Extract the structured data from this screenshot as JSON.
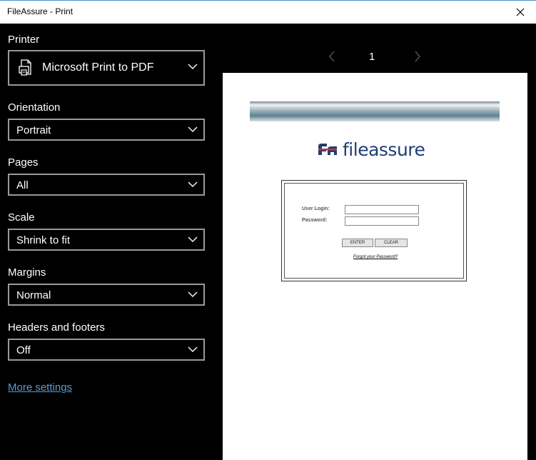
{
  "window": {
    "title": "FileAssure - Print"
  },
  "printer": {
    "label": "Printer",
    "value": "Microsoft Print to PDF"
  },
  "orientation": {
    "label": "Orientation",
    "value": "Portrait"
  },
  "pages": {
    "label": "Pages",
    "value": "All"
  },
  "scale": {
    "label": "Scale",
    "value": "Shrink to fit"
  },
  "margins": {
    "label": "Margins",
    "value": "Normal"
  },
  "headers_footers": {
    "label": "Headers and footers",
    "value": "Off"
  },
  "more_settings": "More settings",
  "pager": {
    "page": "1"
  },
  "preview": {
    "logo_text": "fileassure",
    "user_login_label": "User Login:",
    "password_label": "Password:",
    "enter_label": "ENTER",
    "clear_label": "CLEAR",
    "forgot_link": "Forgot your Password?"
  },
  "colors": {
    "accent": "#4a90c9",
    "link": "#5b9bd5",
    "brand_navy": "#1d3f73"
  }
}
